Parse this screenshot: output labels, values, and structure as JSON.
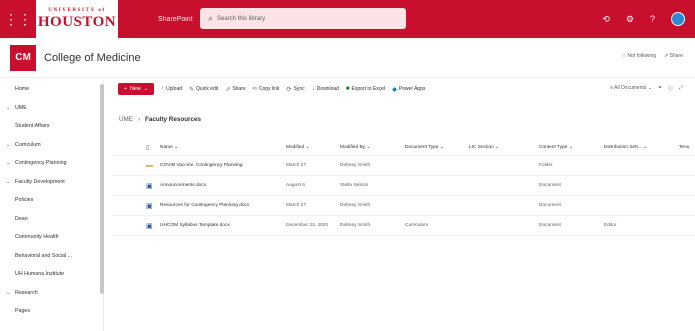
{
  "suite": {
    "logo_small": "UNIVERSITY of",
    "logo_big": "HOUSTON",
    "app_name": "SharePoint",
    "search_placeholder": "Search this library"
  },
  "site": {
    "logo_text": "CM",
    "title": "College of Medicine",
    "not_following": "Not following",
    "share": "Share"
  },
  "nav": {
    "items": [
      {
        "label": "Home",
        "chev": ""
      },
      {
        "label": "UME",
        "chev": "⌄"
      },
      {
        "label": "Student Affairs",
        "chev": ""
      },
      {
        "label": "Curriculum",
        "chev": "⌄"
      },
      {
        "label": "Contingency Planning",
        "chev": "⌄"
      },
      {
        "label": "Faculty Development",
        "chev": "⌄"
      },
      {
        "label": "Policies",
        "chev": ""
      },
      {
        "label": "Dean",
        "chev": ""
      },
      {
        "label": "Community Health",
        "chev": ""
      },
      {
        "label": "Behavioral and Social ...",
        "chev": ""
      },
      {
        "label": "UH Humana Institute",
        "chev": ""
      },
      {
        "label": "Research",
        "chev": "⌄"
      },
      {
        "label": "Pages",
        "chev": ""
      }
    ]
  },
  "cmdbar": {
    "new_label": "New",
    "upload": "Upload",
    "quick_edit": "Quick edit",
    "share": "Share",
    "copy_link": "Copy link",
    "sync": "Sync",
    "download": "Download",
    "export_excel": "Export to Excel",
    "power_apps": "Power Apps",
    "all_documents": "All Documents"
  },
  "breadcrumb": {
    "root": "UME",
    "current": "Faculty Resources"
  },
  "columns": {
    "name": "Name",
    "modified": "Modified",
    "modified_by": "Modified By",
    "document_type": "Document Type",
    "lic_section": "LIC Section",
    "content_type": "Content Type",
    "distribution": "Distribution Sett...",
    "rest": "Tenu"
  },
  "rows": [
    {
      "name": "COVID Vaccine, Contingency Planning",
      "modified": "March 27",
      "modified_by": "Debney Smith",
      "doctype": "",
      "lic": "",
      "ctype": "Folder",
      "dist": "",
      "icon": "folder"
    },
    {
      "name": "Announcements.docx",
      "modified": "August 6",
      "modified_by": "Stella Nelson",
      "doctype": "",
      "lic": "",
      "ctype": "Document",
      "dist": "",
      "icon": "doc"
    },
    {
      "name": "Resources for Contingency Planning.docx",
      "modified": "March 27",
      "modified_by": "Debney Smith",
      "doctype": "",
      "lic": "",
      "ctype": "Document",
      "dist": "",
      "icon": "doc"
    },
    {
      "name": "UHCOM Syllabus Template.docx",
      "modified": "December 23, 2020",
      "modified_by": "Debney Smith",
      "doctype": "Curriculum",
      "lic": "",
      "ctype": "Document",
      "dist": "Editor",
      "icon": "doc"
    }
  ]
}
